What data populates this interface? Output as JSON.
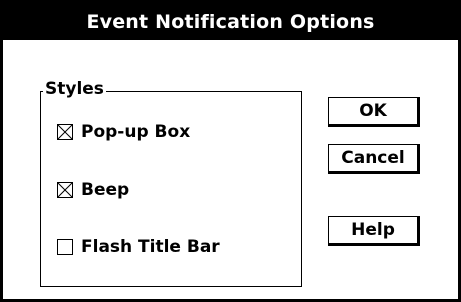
{
  "dialog": {
    "title": "Event Notification Options"
  },
  "styles_group": {
    "label": "Styles",
    "options": [
      {
        "label": "Pop-up Box",
        "checked": true
      },
      {
        "label": "Beep",
        "checked": true
      },
      {
        "label": "Flash Title Bar",
        "checked": false
      }
    ]
  },
  "buttons": {
    "ok": "OK",
    "cancel": "Cancel",
    "help": "Help"
  }
}
